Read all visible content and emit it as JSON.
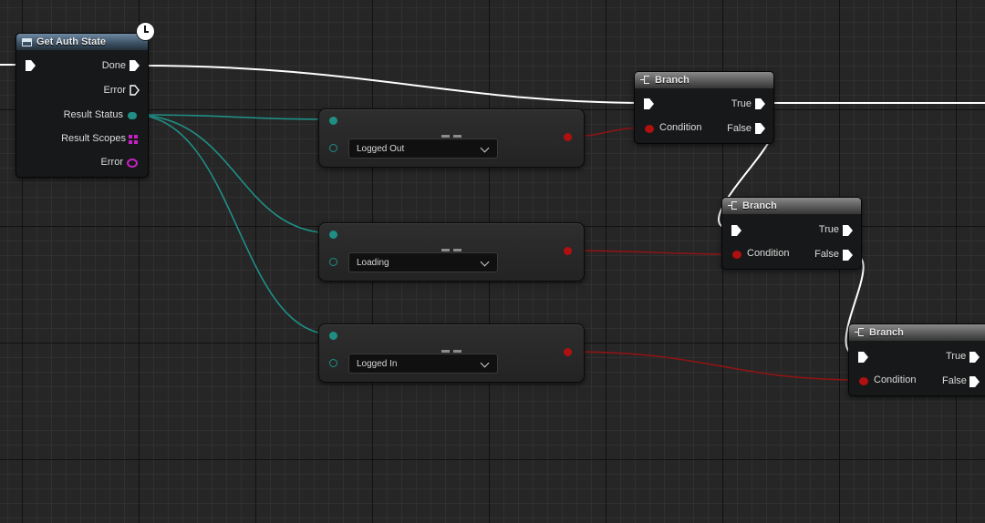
{
  "get_auth_state": {
    "title": "Get Auth State",
    "pins": {
      "done": "Done",
      "error_exec": "Error",
      "result_status": "Result Status",
      "result_scopes": "Result Scopes",
      "error_data": "Error"
    }
  },
  "compare_nodes": [
    {
      "value": "Logged Out"
    },
    {
      "value": "Loading"
    },
    {
      "value": "Logged In"
    }
  ],
  "branches": [
    {
      "title": "Branch",
      "condition": "Condition",
      "true_label": "True",
      "false_label": "False"
    },
    {
      "title": "Branch",
      "condition": "Condition",
      "true_label": "True",
      "false_label": "False"
    },
    {
      "title": "Branch",
      "condition": "Condition",
      "true_label": "True",
      "false_label": "False"
    }
  ],
  "colors": {
    "exec_wire": "#ffffff",
    "enum_wire": "#1f8f86",
    "bool_wire": "#8e1414",
    "function_header": "#3e5468",
    "branch_header": "#5a5a5a"
  },
  "icons": [
    "function-icon",
    "latent-clock-icon",
    "branch-icon",
    "equals-icon",
    "chevron-down-icon"
  ]
}
